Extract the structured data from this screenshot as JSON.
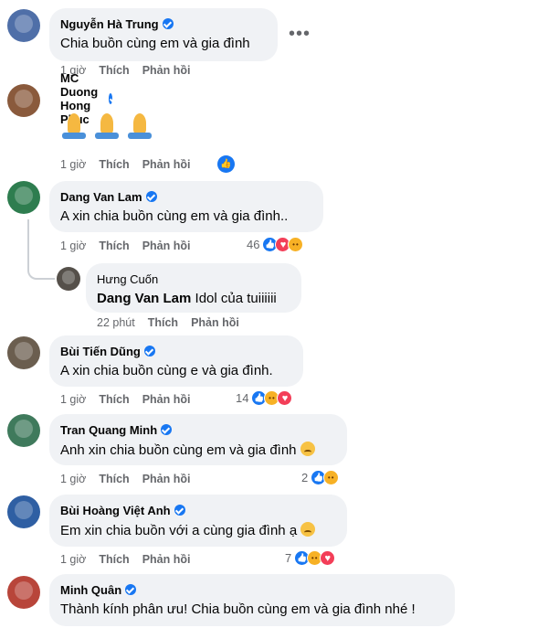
{
  "actions": {
    "like": "Thích",
    "reply": "Phản hồi"
  },
  "comments": [
    {
      "author": "Nguyễn Hà Trung",
      "text": "Chia buồn cùng em và gia đình",
      "time": "1 giờ",
      "more": "•••"
    },
    {
      "author": "MC Duong Hong Phuc",
      "time": "1 giờ"
    },
    {
      "author": "Dang Van Lam",
      "text": "A xin chia buồn cùng em và gia đình..",
      "time": "1 giờ",
      "reaction_count": "46"
    },
    {
      "author": "Hưng Cuốn",
      "mention": "Dang Van Lam",
      "text": " Idol của tuiiiiii",
      "time": "22 phút"
    },
    {
      "author": "Bùi Tiến Dũng",
      "text": "A xin chia buồn cùng e và gia đình.",
      "time": "1 giờ",
      "reaction_count": "14"
    },
    {
      "author": "Tran Quang Minh",
      "text": "Anh xin chia buồn cùng em và gia đình",
      "time": "1 giờ",
      "reaction_count": "2"
    },
    {
      "author": "Bùi Hoàng Việt Anh",
      "text": "Em xin chia buồn với a cùng gia đình ạ",
      "time": "1 giờ",
      "reaction_count": "7"
    },
    {
      "author": "Minh Quân",
      "text": "Thành kính phân ưu! Chia buồn cùng em và gia đình nhé !"
    }
  ],
  "colors": {
    "bubble": "#f0f2f5",
    "meta": "#65676b",
    "accent": "#1877f2",
    "love": "#f33e58",
    "sad": "#f7b125"
  }
}
